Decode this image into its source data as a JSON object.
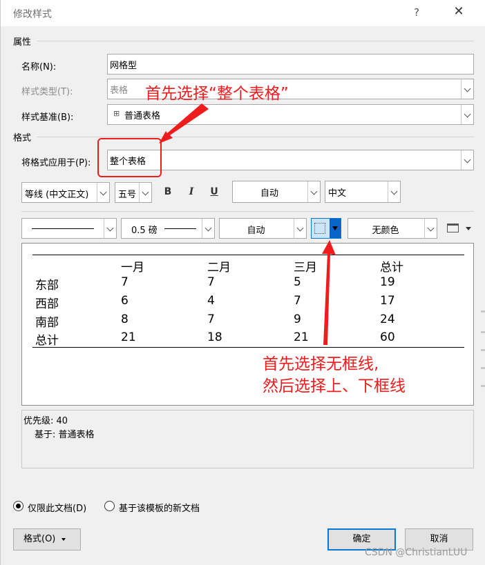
{
  "window": {
    "title": "修改样式",
    "help": "?",
    "close": "✕"
  },
  "properties": {
    "section": "属性",
    "name_label": "名称(N):",
    "name_value": "网格型",
    "type_label": "样式类型(T):",
    "type_value": "表格",
    "base_label": "样式基准(B):",
    "base_value": "普通表格"
  },
  "format": {
    "section": "格式",
    "apply_label": "将格式应用于(P):",
    "apply_value": "整个表格",
    "font": "等线 (中文正文)",
    "size": "五号",
    "bold": "B",
    "italic": "I",
    "underline": "U",
    "color": "自动",
    "script": "中文",
    "line_weight": "0.5 磅",
    "border_color": "自动",
    "shading": "无颜色"
  },
  "preview": {
    "header": [
      "",
      "一月",
      "二月",
      "三月",
      "总计"
    ],
    "rows": [
      [
        "东部",
        "7",
        "7",
        "5",
        "19"
      ],
      [
        "西部",
        "6",
        "4",
        "7",
        "17"
      ],
      [
        "南部",
        "8",
        "7",
        "9",
        "24"
      ],
      [
        "总计",
        "21",
        "18",
        "21",
        "60"
      ]
    ]
  },
  "description": {
    "priority": "优先级: 40",
    "based_on": "基于: 普通表格"
  },
  "scope": {
    "this_doc": "仅限此文档(D)",
    "template": "基于该模板的新文档"
  },
  "buttons": {
    "format": "格式(O)",
    "ok": "确定",
    "cancel": "取消"
  },
  "annotations": {
    "top": "首先选择“整个表格”",
    "bottom_line1": "首先选择无框线,",
    "bottom_line2": "然后选择上、下框线"
  },
  "watermark": "CSDN @ChristianLUU",
  "colors": {
    "annotation": "#ee1c1c",
    "accent": "#0078d7"
  }
}
